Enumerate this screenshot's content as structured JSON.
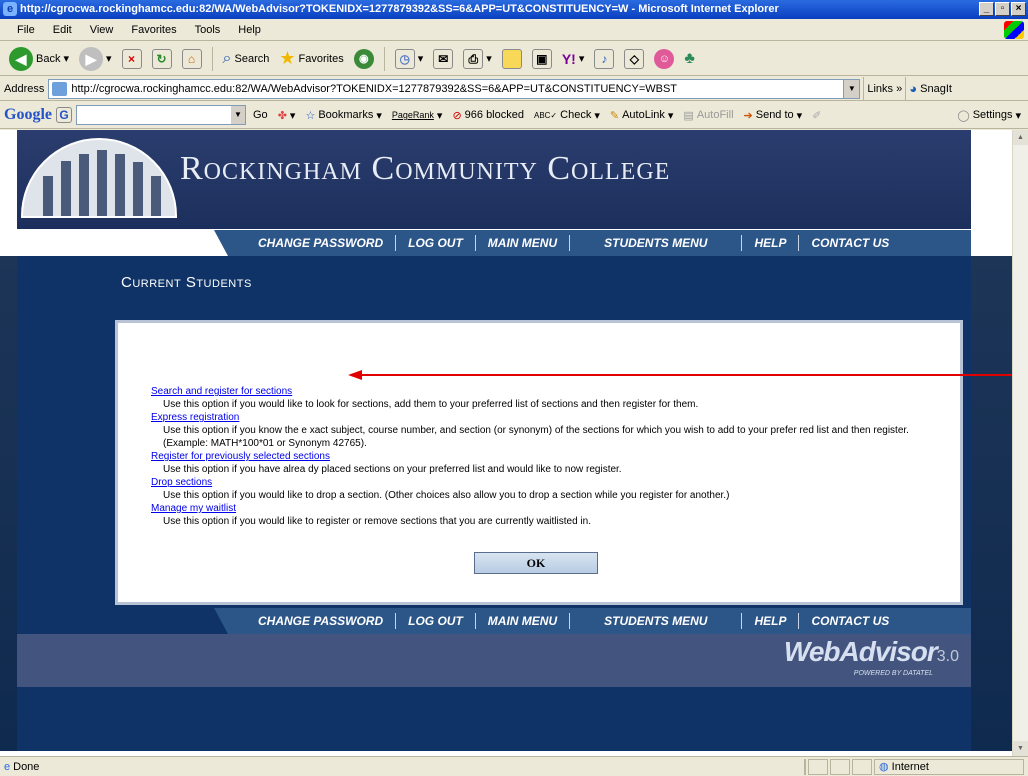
{
  "window": {
    "title": "http://cgrocwa.rockinghamcc.edu:82/WA/WebAdvisor?TOKENIDX=1277879392&SS=6&APP=UT&CONSTITUENCY=W - Microsoft Internet Explorer"
  },
  "menubar": [
    "File",
    "Edit",
    "View",
    "Favorites",
    "Tools",
    "Help"
  ],
  "toolbar": {
    "back": "Back",
    "search": "Search",
    "favorites": "Favorites"
  },
  "address": {
    "label": "Address",
    "url": "http://cgrocwa.rockinghamcc.edu:82/WA/WebAdvisor?TOKENIDX=1277879392&SS=6&APP=UT&CONSTITUENCY=WBST",
    "links": "Links",
    "snagit": "SnagIt"
  },
  "googlebar": {
    "logo": "Google",
    "go": "Go",
    "bookmarks": "Bookmarks",
    "pagerank": "PageRank",
    "blocked": "966 blocked",
    "check": "Check",
    "autolink": "AutoLink",
    "autofill": "AutoFill",
    "sendto": "Send to",
    "settings": "Settings"
  },
  "page": {
    "college": "Rockingham Community College",
    "nav": [
      "Change Password",
      "Log Out",
      "Main Menu",
      "Students Menu",
      "Help",
      "Contact Us"
    ],
    "section_title": "Current Students",
    "options": [
      {
        "link": "Search and register for sections",
        "desc": "Use this option if you would like to look for sections, add them to your preferred list of sections and then register for them."
      },
      {
        "link": "Express registration",
        "desc": "Use this option if you know the e xact subject, course number, and section (or synonym) of the sections for which you wish to add to your prefer red list and then register. (Example: MATH*100*01 or Synonym 42765)."
      },
      {
        "link": "Register for previously selected sections",
        "desc": "Use this option if you have alrea dy placed sections on your preferred list and would like to now register."
      },
      {
        "link": "Drop sections",
        "desc": "Use this option if you would like to drop a section. (Other choices also allow you to drop a section while you register for another.)"
      },
      {
        "link": "Manage my waitlist",
        "desc": "Use this option if you would like to register or remove sections that you are currently waitlisted in."
      }
    ],
    "ok": "OK",
    "brand": "WebAdvisor",
    "version": "3.0",
    "powered": "POWERED BY DATATEL"
  },
  "status": {
    "left": "Done",
    "zone": "Internet"
  },
  "colors": {
    "arrow": "#e00000",
    "nav_bg": "#2c5588",
    "link": "#0000ee"
  }
}
